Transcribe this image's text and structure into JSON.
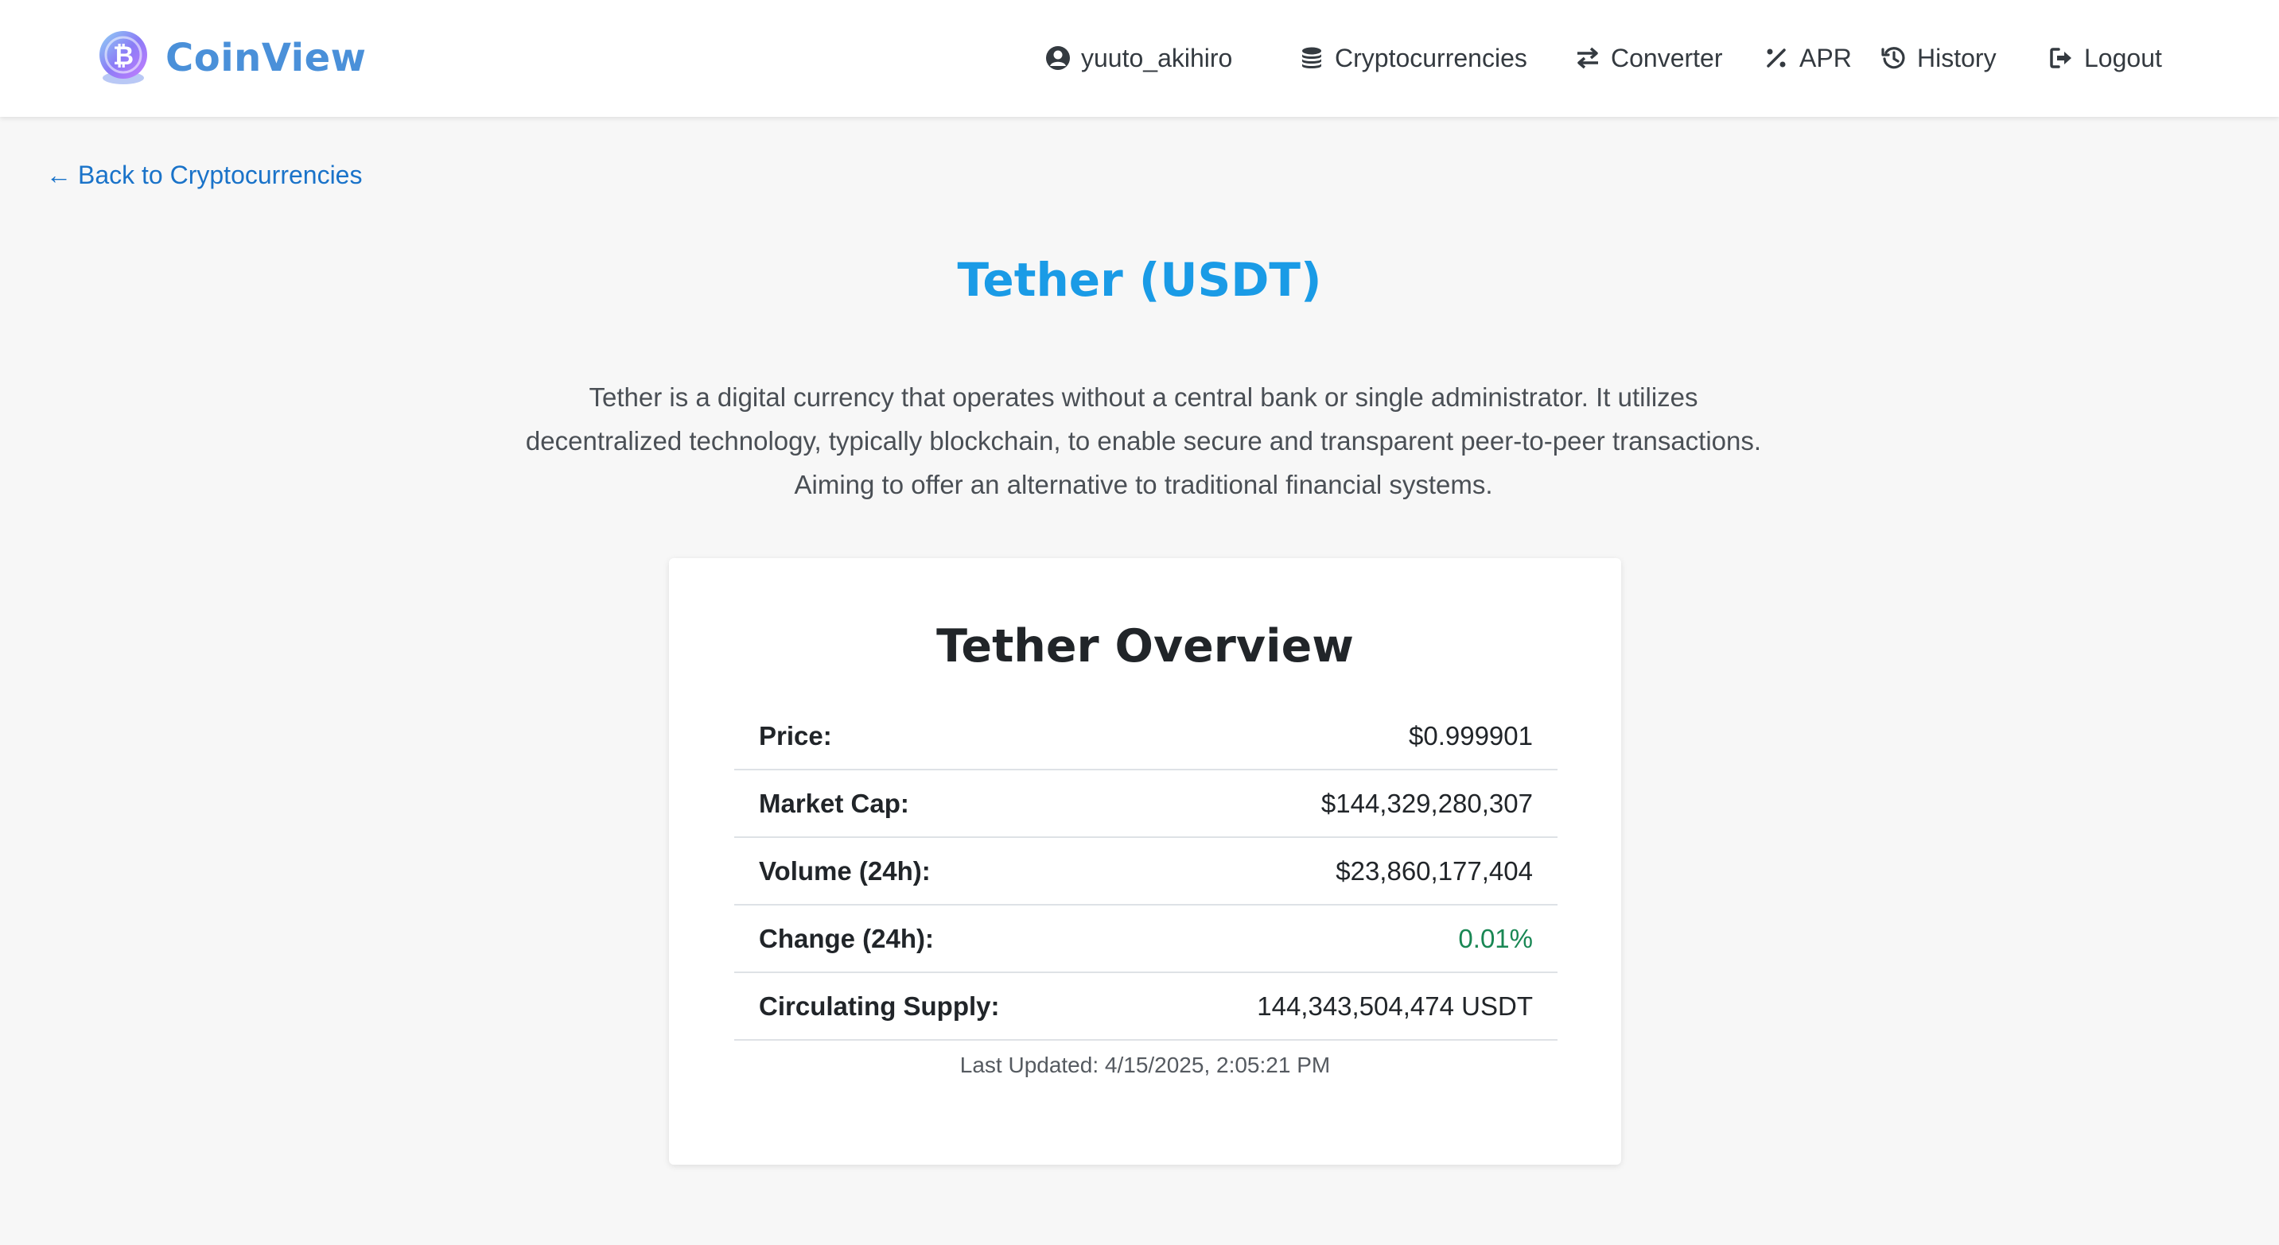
{
  "brand": {
    "name": "CoinView"
  },
  "nav": {
    "user": "yuuto_akihiro",
    "items": [
      {
        "label": "Cryptocurrencies",
        "icon": "coins-icon"
      },
      {
        "label": "Converter",
        "icon": "exchange-icon"
      },
      {
        "label": "APR",
        "icon": "percent-icon"
      },
      {
        "label": "History",
        "icon": "history-icon"
      },
      {
        "label": "Logout",
        "icon": "logout-icon"
      }
    ]
  },
  "back_link": {
    "arrow": "←",
    "label": "Back to Cryptocurrencies"
  },
  "coin": {
    "title": "Tether (USDT)",
    "description": "Tether is a digital currency that operates without a central bank or single administrator. It utilizes decentralized technology, typically blockchain, to enable secure and transparent peer-to-peer transactions. Aiming to offer an alternative to traditional financial systems."
  },
  "overview": {
    "title": "Tether Overview",
    "rows": [
      {
        "label": "Price:",
        "value": "$0.999901"
      },
      {
        "label": "Market Cap:",
        "value": "$144,329,280,307"
      },
      {
        "label": "Volume (24h):",
        "value": "$23,860,177,404"
      },
      {
        "label": "Change (24h):",
        "value": "0.01%"
      },
      {
        "label": "Circulating Supply:",
        "value": "144,343,504,474 USDT"
      }
    ],
    "last_updated": "Last Updated: 4/15/2025, 2:05:21 PM"
  },
  "colors": {
    "brand": "#4a90d9",
    "title": "#1a9be6",
    "link": "#1a73c9",
    "positive_change": "#198754"
  }
}
